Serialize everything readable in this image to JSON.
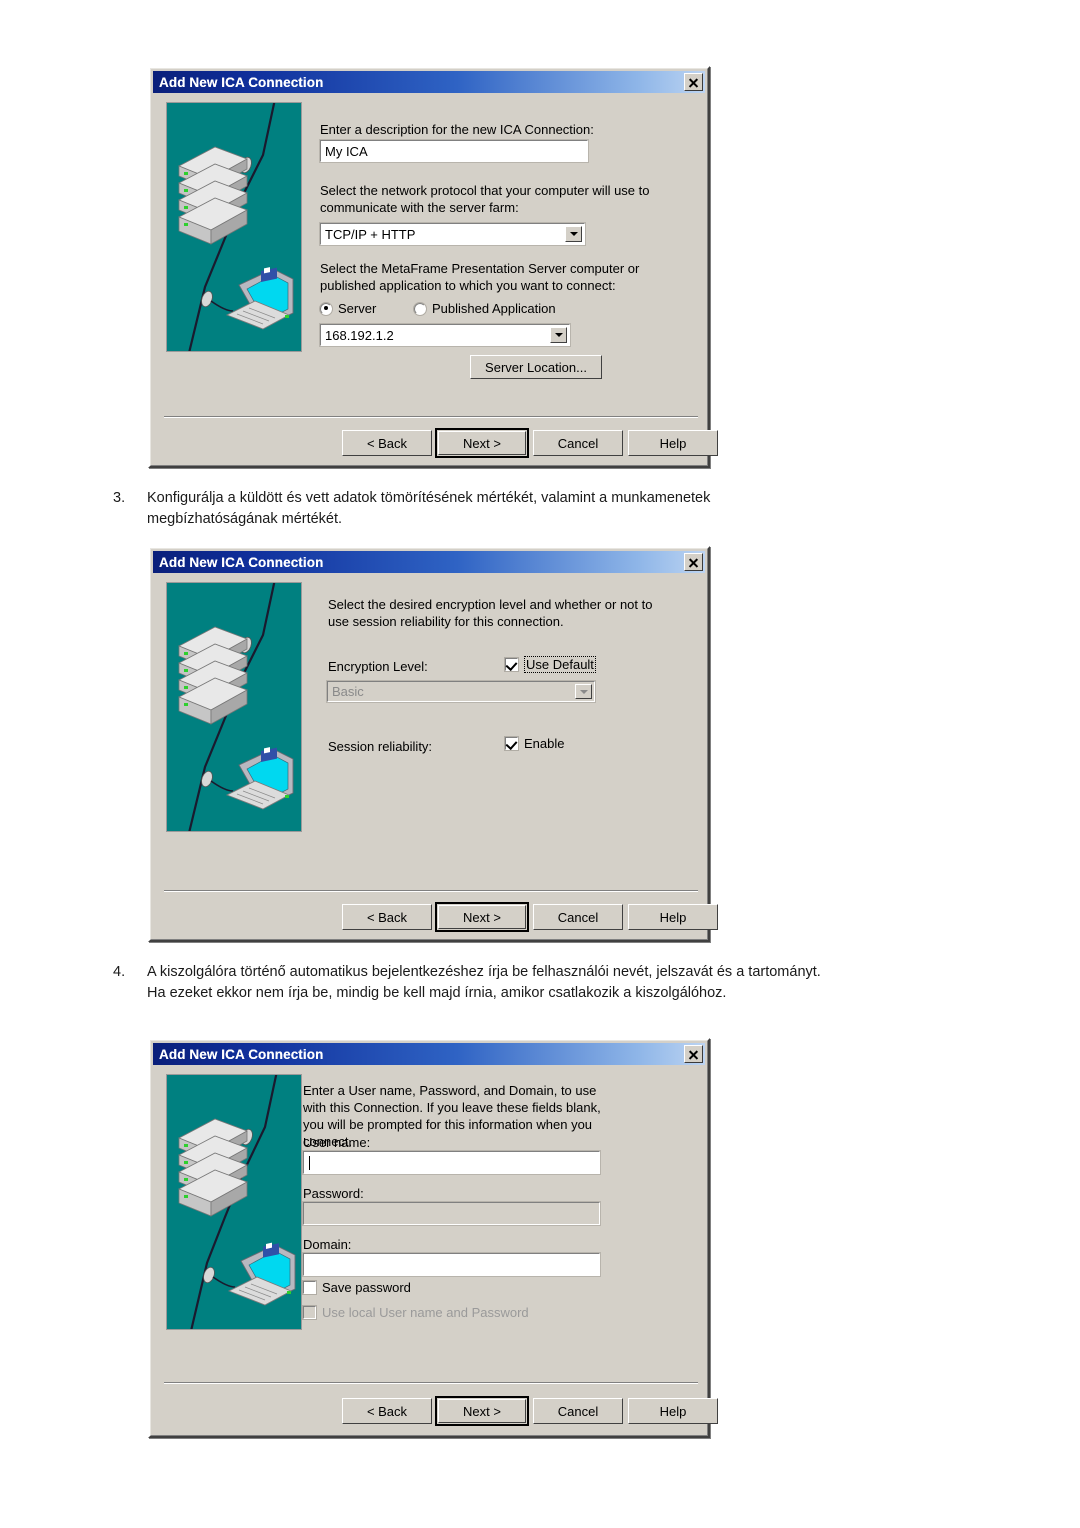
{
  "document": {
    "steps": [
      {
        "number": "3.",
        "text": "Konfigurálja a küldött és vett adatok tömörítésének mértékét, valamint a munkamenetek megbízhatóságának mértékét."
      },
      {
        "number": "4.",
        "text": "A kiszolgálóra történő automatikus bejelentkezéshez írja be felhasználói nevét, jelszavát és a tartományt. Ha ezeket ekkor nem írja be, mindig be kell majd írnia, amikor csatlakozik a kiszolgálóhoz."
      }
    ]
  },
  "colors": {
    "titlebar_start": "#0a1f7a",
    "titlebar_end": "#bcd4f2",
    "dialog_face": "#d4d0c8",
    "illustration_bg": "#008080",
    "laptop_screen": "#00d8f0"
  },
  "dialog1": {
    "title": "Add New ICA Connection",
    "close_label": "x",
    "description_label": "Enter a description for the new ICA Connection:",
    "description_value": "My ICA",
    "protocol_label": "Select the network protocol that your computer will use to communicate with the server farm:",
    "protocol_value": "TCP/IP + HTTP",
    "target_label": "Select the MetaFrame Presentation Server computer or published application to which you want to connect:",
    "radio_server": "Server",
    "radio_published": "Published Application",
    "server_value": "168.192.1.2",
    "server_location_button": "Server Location...",
    "buttons": {
      "back": "< Back",
      "next": "Next >",
      "cancel": "Cancel",
      "help": "Help"
    }
  },
  "dialog2": {
    "title": "Add New ICA Connection",
    "close_label": "x",
    "intro": "Select the desired encryption level and whether or not to use session reliability for this connection.",
    "encryption_label": "Encryption Level:",
    "use_default_label": "Use Default",
    "use_default_checked": true,
    "encryption_value": "Basic",
    "session_reliability_label": "Session reliability:",
    "enable_label": "Enable",
    "enable_checked": true,
    "buttons": {
      "back": "< Back",
      "next": "Next >",
      "cancel": "Cancel",
      "help": "Help"
    }
  },
  "dialog3": {
    "title": "Add New ICA Connection",
    "close_label": "x",
    "intro": "Enter a User name, Password, and Domain, to use with this Connection.  If you leave these fields blank, you will be prompted for this information when you connect.",
    "username_label": "User name:",
    "username_value": "",
    "password_label": "Password:",
    "password_value": "",
    "domain_label": "Domain:",
    "domain_value": "",
    "save_password_label": "Save password",
    "save_password_checked": false,
    "use_local_label": "Use local User name and Password",
    "use_local_checked": false,
    "buttons": {
      "back": "< Back",
      "next": "Next >",
      "cancel": "Cancel",
      "help": "Help"
    }
  }
}
